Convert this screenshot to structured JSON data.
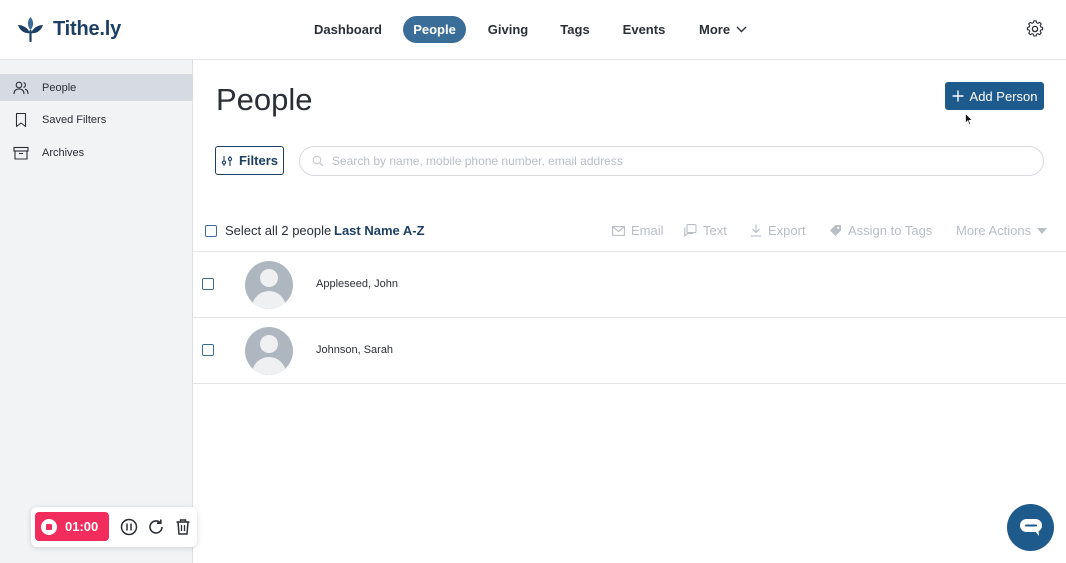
{
  "app": {
    "logo_text": "Tithe.ly"
  },
  "nav": {
    "items": [
      {
        "label": "Dashboard"
      },
      {
        "label": "People"
      },
      {
        "label": "Giving"
      },
      {
        "label": "Tags"
      },
      {
        "label": "Events"
      },
      {
        "label": "More"
      }
    ],
    "active": "People"
  },
  "sidebar": {
    "items": [
      {
        "label": "People",
        "icon": "users-icon"
      },
      {
        "label": "Saved Filters",
        "icon": "bookmark-icon"
      },
      {
        "label": "Archives",
        "icon": "archive-box-icon"
      }
    ]
  },
  "main": {
    "title": "People",
    "add_button": "Add Person",
    "filters_button": "Filters",
    "search_placeholder": "Search by name, mobile phone number, email address",
    "select_all": "Select all 2 people",
    "sort": "Last Name A-Z",
    "actions": {
      "email": "Email",
      "text": "Text",
      "export": "Export",
      "assign_tags": "Assign to Tags",
      "more_actions": "More Actions"
    },
    "people": [
      {
        "name": "Appleseed, John"
      },
      {
        "name": "Johnson, Sarah"
      }
    ]
  },
  "recorder": {
    "time": "01:00"
  },
  "colors": {
    "brand": "#1c3f63",
    "nav_active": "#3b6d99",
    "primary_button": "#1f5a8c",
    "record": "#f22c5d"
  }
}
